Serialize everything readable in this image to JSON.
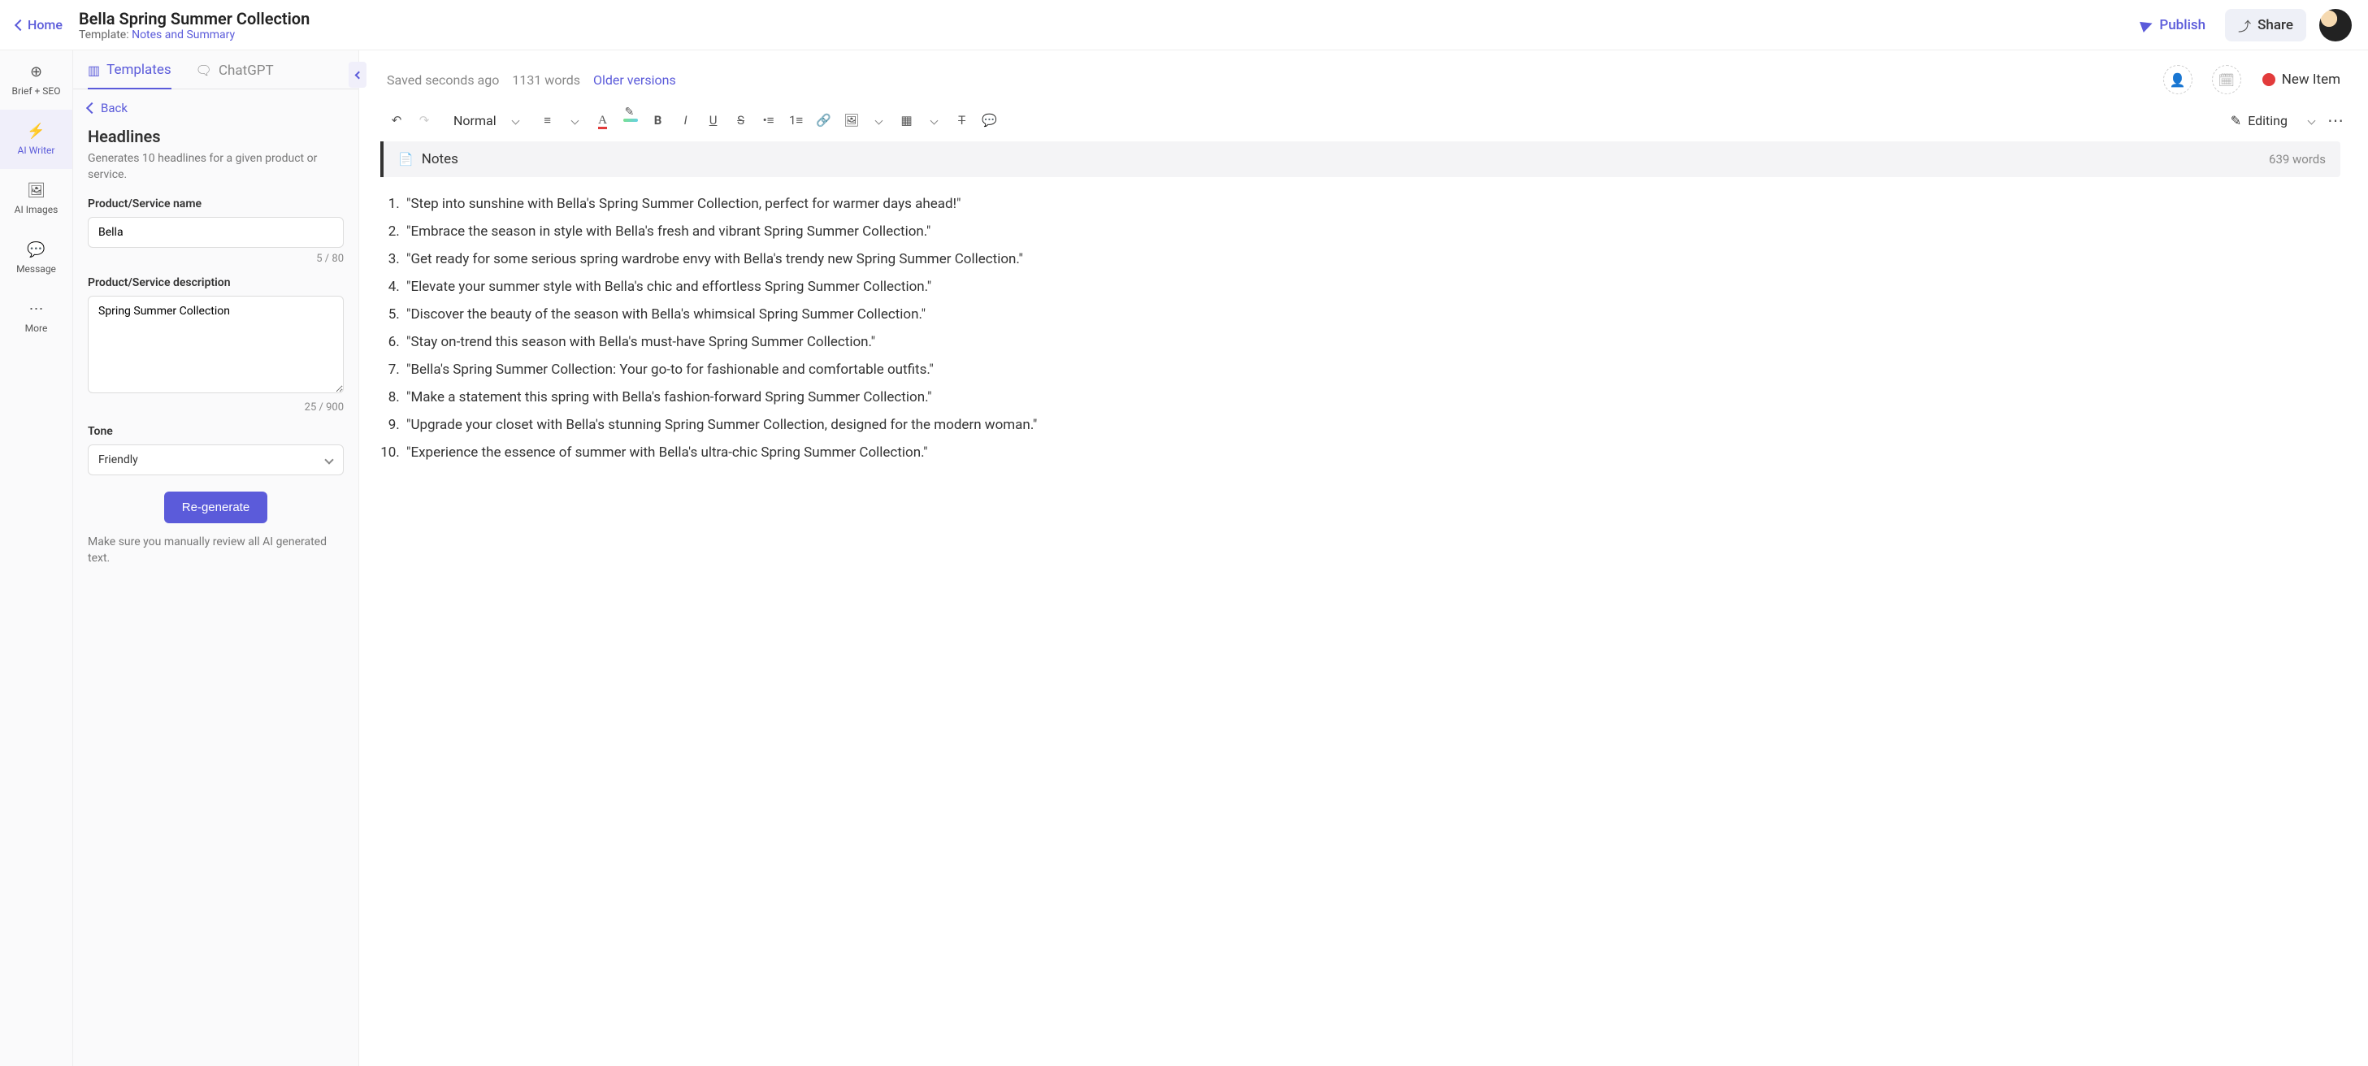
{
  "home_label": "Home",
  "doc_title": "Bella Spring Summer Collection",
  "template_prefix": "Template: ",
  "template_name": "Notes and Summary",
  "publish_label": "Publish",
  "share_label": "Share",
  "leftnav": {
    "briefseo": "Brief + SEO",
    "aiwriter": "AI Writer",
    "aiimages": "AI Images",
    "message": "Message",
    "more": "More"
  },
  "sidebar_tabs": {
    "templates": "Templates",
    "chatgpt": "ChatGPT"
  },
  "back_label": "Back",
  "sidebar_title": "Headlines",
  "sidebar_desc": "Generates 10 headlines for a given product or service.",
  "form": {
    "name_label": "Product/Service name",
    "name_value": "Bella",
    "name_count": "5 / 80",
    "desc_label": "Product/Service description",
    "desc_value": "Spring Summer Collection",
    "desc_count": "25 / 900",
    "tone_label": "Tone",
    "tone_value": "Friendly",
    "regen": "Re-generate",
    "regen_note": "Make sure you manually review all AI generated text."
  },
  "status": {
    "saved": "Saved seconds ago",
    "words": "1131 words",
    "older": "Older versions",
    "newitem": "New Item"
  },
  "toolbar": {
    "style": "Normal",
    "editing": "Editing"
  },
  "notes": {
    "label": "Notes",
    "words": "639 words"
  },
  "headlines": [
    "\"Step into sunshine with Bella's Spring Summer Collection, perfect for warmer days ahead!\"",
    "\"Embrace the season in style with Bella's fresh and vibrant Spring Summer Collection.\"",
    "\"Get ready for some serious spring wardrobe envy with Bella's trendy new Spring Summer Collection.\"",
    "\"Elevate your summer style with Bella's chic and effortless Spring Summer Collection.\"",
    "\"Discover the beauty of the season with Bella's whimsical Spring Summer Collection.\"",
    "\"Stay on-trend this season with Bella's must-have Spring Summer Collection.\"",
    "\"Bella's Spring Summer Collection: Your go-to for fashionable and comfortable outfits.\"",
    "\"Make a statement this spring with Bella's fashion-forward Spring Summer Collection.\"",
    "\"Upgrade your closet with Bella's stunning Spring Summer Collection, designed for the modern woman.\"",
    "\"Experience the essence of summer with Bella's ultra-chic Spring Summer Collection.\""
  ]
}
